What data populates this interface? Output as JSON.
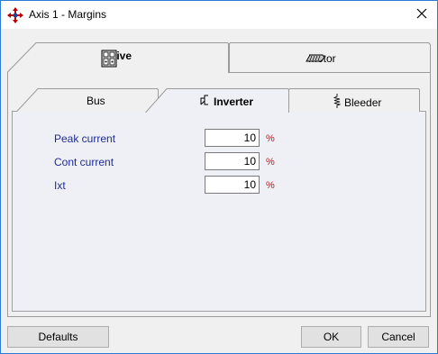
{
  "window": {
    "title": "Axis 1 - Margins"
  },
  "outer_tabs": [
    {
      "label": "Drive",
      "selected": true,
      "icon": "drive-module-icon"
    },
    {
      "label": "Motor",
      "selected": false,
      "icon": "motor-icon"
    }
  ],
  "inner_tabs": [
    {
      "label": "Bus",
      "selected": false
    },
    {
      "label": "Inverter",
      "selected": true,
      "icon": "inverter-icon"
    },
    {
      "label": "Bleeder",
      "selected": false,
      "icon": "resistor-icon"
    }
  ],
  "fields": [
    {
      "label": "Peak current",
      "value": "10",
      "unit": "%"
    },
    {
      "label": "Cont current",
      "value": "10",
      "unit": "%"
    },
    {
      "label": "Ixt",
      "value": "10",
      "unit": "%"
    }
  ],
  "buttons": {
    "defaults": "Defaults",
    "ok": "OK",
    "cancel": "Cancel"
  },
  "colors": {
    "label_text": "#1f2a8f",
    "unit_text": "#b22222",
    "window_border": "#2b7bd6"
  }
}
